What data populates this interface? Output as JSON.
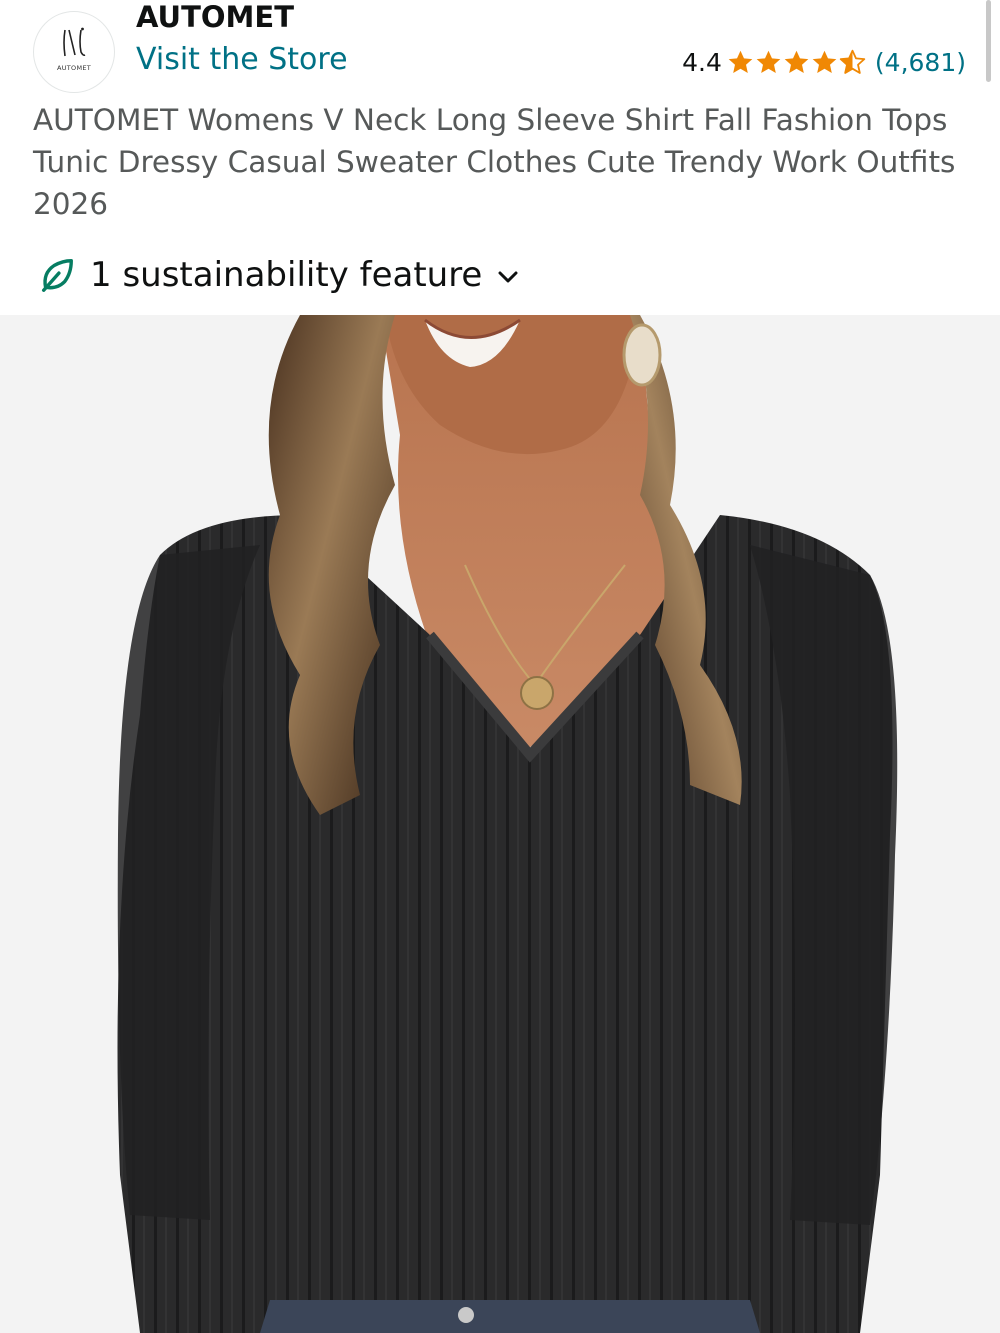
{
  "brand": {
    "logo_text": "AUTOMET",
    "name": "AUTOMET",
    "visit_store": "Visit the Store"
  },
  "rating": {
    "value": "4.4",
    "stars": 4.4,
    "count": "(4,681)"
  },
  "product": {
    "title": "AUTOMET Womens V Neck Long Sleeve Shirt Fall Fashion Tops Tunic Dressy Casual Sweater Clothes Cute Trendy Work Outfits 2026",
    "image_icon": "product-photo"
  },
  "sustainability": {
    "label": "1 sustainability feature",
    "icon": "leaf-icon"
  },
  "colors": {
    "link": "#007185",
    "star": "#f08804",
    "leaf": "#067d62",
    "title_gray": "#565959"
  }
}
